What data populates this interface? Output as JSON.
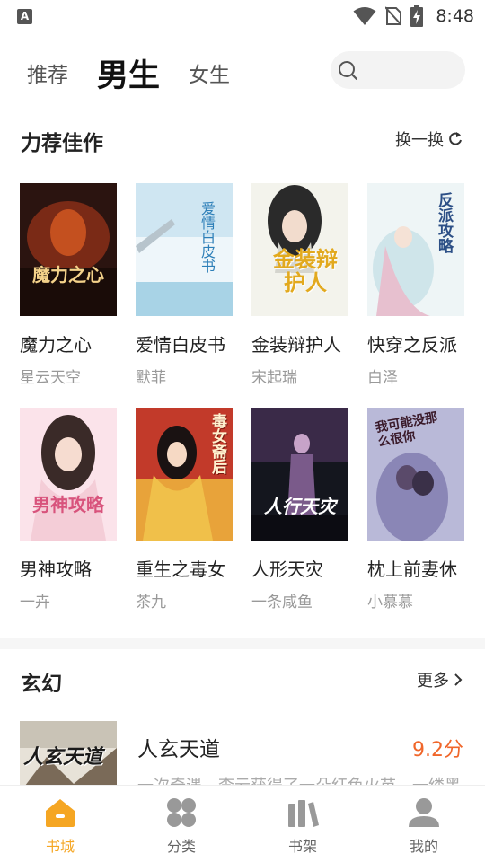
{
  "status_bar": {
    "time": "8:48",
    "app_badge": "A",
    "icons": [
      "wifi-icon",
      "no-sim-icon",
      "battery-charging-icon"
    ]
  },
  "top_tabs": [
    {
      "label": "推荐",
      "active": false
    },
    {
      "label": "男生",
      "active": true
    },
    {
      "label": "女生",
      "active": false
    }
  ],
  "search": {
    "icon": "search-icon",
    "placeholder": ""
  },
  "featured": {
    "title": "力荐佳作",
    "action": "换一换",
    "action_icon": "refresh-icon",
    "books": [
      {
        "title": "魔力之心",
        "author": "星云天空",
        "cover_text": "魔力之心",
        "cover_colors": [
          "#2b1410",
          "#7a2a16"
        ]
      },
      {
        "title": "爱情白皮书",
        "author": "默菲",
        "cover_text": "爱情白皮书",
        "cover_colors": [
          "#cfe6f2",
          "#eef6fa"
        ]
      },
      {
        "title": "金装辩护人",
        "author": "宋起瑞",
        "cover_text": "金装辩护人",
        "cover_colors": [
          "#f3f3ec",
          "#e2e2da"
        ]
      },
      {
        "title": "快穿之反派",
        "author": "白泽",
        "cover_text": "反派攻略",
        "cover_colors": [
          "#eef5f6",
          "#dfeef0"
        ]
      },
      {
        "title": "男神攻略",
        "author": "一卉",
        "cover_text": "男神攻略",
        "cover_colors": [
          "#fbe3ea",
          "#f4cdd7"
        ]
      },
      {
        "title": "重生之毒女",
        "author": "茶九",
        "cover_text": "毒女斋后",
        "cover_colors": [
          "#c23a2a",
          "#e8a33a"
        ]
      },
      {
        "title": "人形天灾",
        "author": "一条咸鱼",
        "cover_text": "人行天灾",
        "cover_colors": [
          "#14161e",
          "#3a2a48"
        ]
      },
      {
        "title": "枕上前妻休",
        "author": "小慕慕",
        "cover_text": "我可能没那么很你",
        "cover_colors": [
          "#b9b9d8",
          "#8a86b6"
        ]
      }
    ]
  },
  "fantasy": {
    "title": "玄幻",
    "action": "更多",
    "action_icon": "chevron-right-icon",
    "items": [
      {
        "title": "人玄天道",
        "score": "9.2分",
        "desc": "一次奇遇，李云获得了一朵红色火苗，一缕黑",
        "cover_text": "人玄天道"
      }
    ]
  },
  "bottom_nav": [
    {
      "label": "书城",
      "icon": "home-icon",
      "active": true
    },
    {
      "label": "分类",
      "icon": "category-icon",
      "active": false
    },
    {
      "label": "书架",
      "icon": "bookshelf-icon",
      "active": false
    },
    {
      "label": "我的",
      "icon": "profile-icon",
      "active": false
    }
  ],
  "colors": {
    "accent": "#f5a623",
    "score": "#f0662a",
    "muted": "#999999",
    "inactive_icon": "#999999"
  }
}
